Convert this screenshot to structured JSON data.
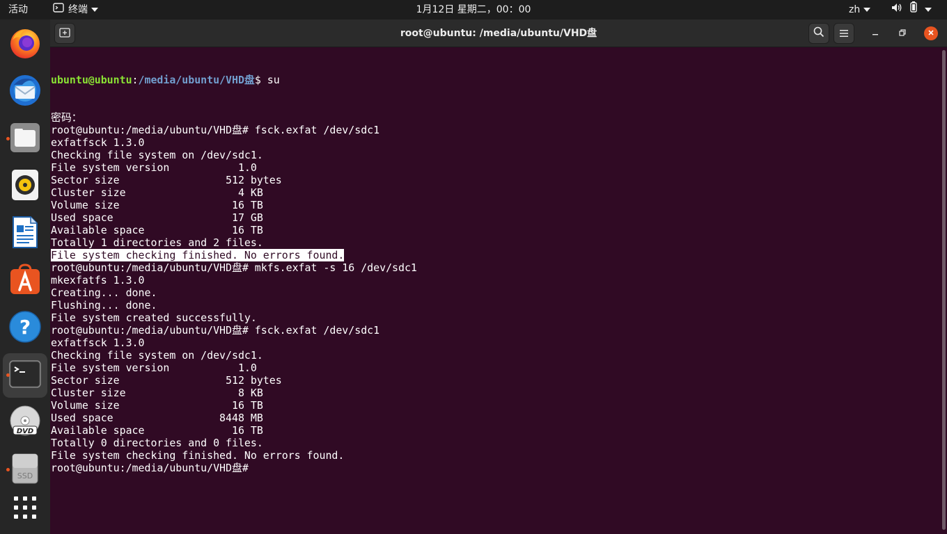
{
  "topbar": {
    "activities": "活动",
    "app_menu": "终端",
    "clock": "1月12日 星期二，00：00",
    "input_method": "zh"
  },
  "dock": {
    "items": [
      {
        "name": "firefox",
        "running": false
      },
      {
        "name": "thunderbird",
        "running": false
      },
      {
        "name": "files",
        "running": true
      },
      {
        "name": "rhythmbox",
        "running": false
      },
      {
        "name": "libreoffice-writer",
        "running": false
      },
      {
        "name": "ubuntu-software",
        "running": false
      },
      {
        "name": "help",
        "running": false
      },
      {
        "name": "terminal",
        "running": true
      },
      {
        "name": "dvd",
        "running": false
      },
      {
        "name": "ssd",
        "running": true
      },
      {
        "name": "show-applications",
        "running": false
      }
    ],
    "dvd_label": "DVD",
    "ssd_label": "SSD"
  },
  "window": {
    "title": "root@ubuntu: /media/ubuntu/VHD盘"
  },
  "terminal": {
    "first_prompt": {
      "user": "ubuntu@ubuntu",
      "sep": ":",
      "path": "/media/ubuntu/VHD盘",
      "symbol": "$ ",
      "command": "su"
    },
    "highlighted_line_index": 11,
    "lines": [
      "密码：",
      "root@ubuntu:/media/ubuntu/VHD盘# fsck.exfat /dev/sdc1",
      "exfatfsck 1.3.0",
      "Checking file system on /dev/sdc1.",
      "File system version           1.0",
      "Sector size                 512 bytes",
      "Cluster size                  4 KB",
      "Volume size                  16 TB",
      "Used space                   17 GB",
      "Available space              16 TB",
      "Totally 1 directories and 2 files.",
      "File system checking finished. No errors found.",
      "root@ubuntu:/media/ubuntu/VHD盘# mkfs.exfat -s 16 /dev/sdc1",
      "mkexfatfs 1.3.0",
      "Creating... done.",
      "Flushing... done.",
      "File system created successfully.",
      "root@ubuntu:/media/ubuntu/VHD盘# fsck.exfat /dev/sdc1",
      "exfatfsck 1.3.0",
      "Checking file system on /dev/sdc1.",
      "File system version           1.0",
      "Sector size                 512 bytes",
      "Cluster size                  8 KB",
      "Volume size                  16 TB",
      "Used space                 8448 MB",
      "Available space              16 TB",
      "Totally 0 directories and 0 files.",
      "File system checking finished. No errors found.",
      "root@ubuntu:/media/ubuntu/VHD盘# "
    ]
  },
  "colors": {
    "terminal_bg": "#300a24",
    "prompt_user": "#8ae234",
    "prompt_path": "#729fcf",
    "accent": "#e95420"
  }
}
